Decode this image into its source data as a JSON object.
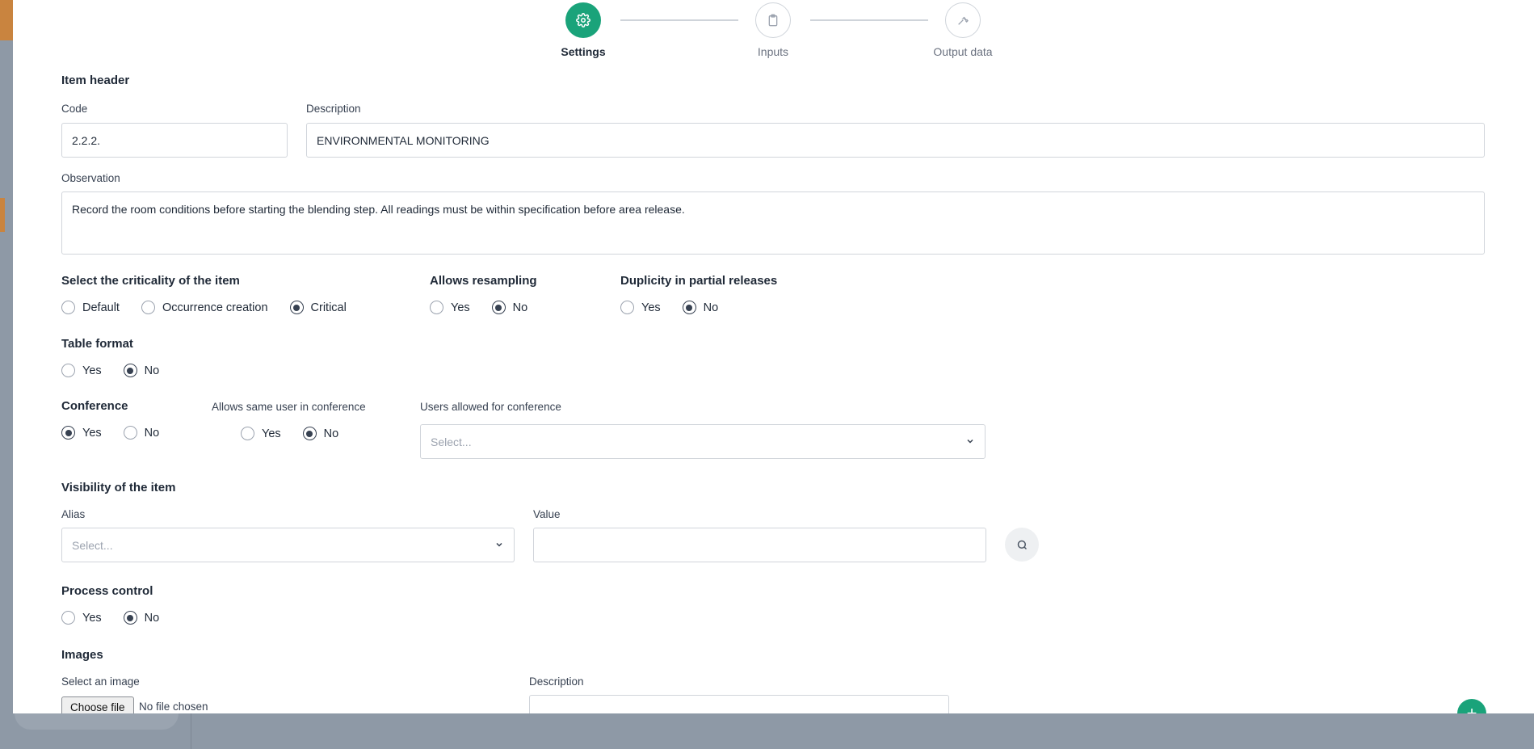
{
  "stepper": {
    "steps": [
      {
        "label": "Settings",
        "icon": "gear-icon",
        "active": true
      },
      {
        "label": "Inputs",
        "icon": "clipboard-icon",
        "active": false
      },
      {
        "label": "Output data",
        "icon": "wrench-icon",
        "active": false
      }
    ]
  },
  "item_header": {
    "title": "Item header",
    "code_label": "Code",
    "code_value": "2.2.2.",
    "description_label": "Description",
    "description_value": "ENVIRONMENTAL MONITORING",
    "observation_label": "Observation",
    "observation_value": "Record the room conditions before starting the blending step. All readings must be within specification before area release."
  },
  "criticality": {
    "title": "Select the criticality of the item",
    "options": [
      "Default",
      "Occurrence creation",
      "Critical"
    ],
    "selected": "Critical"
  },
  "resampling": {
    "title": "Allows resampling",
    "options": [
      "Yes",
      "No"
    ],
    "selected": "No"
  },
  "duplicity": {
    "title": "Duplicity in partial releases",
    "options": [
      "Yes",
      "No"
    ],
    "selected": "No"
  },
  "table_format": {
    "title": "Table format",
    "options": [
      "Yes",
      "No"
    ],
    "selected": "No"
  },
  "conference": {
    "title": "Conference",
    "options": [
      "Yes",
      "No"
    ],
    "selected": "Yes",
    "same_user_label": "Allows same user in conference",
    "same_user_options": [
      "Yes",
      "No"
    ],
    "same_user_selected": "No",
    "users_label": "Users allowed for conference",
    "users_placeholder": "Select..."
  },
  "visibility": {
    "title": "Visibility of the item",
    "alias_label": "Alias",
    "alias_placeholder": "Select...",
    "value_label": "Value",
    "value_value": ""
  },
  "process_control": {
    "title": "Process control",
    "options": [
      "Yes",
      "No"
    ],
    "selected": "No"
  },
  "images": {
    "title": "Images",
    "select_label": "Select an image",
    "choose_file_label": "Choose file",
    "file_status": "No file chosen",
    "description_label": "Description"
  },
  "fab": {
    "label": "+"
  },
  "colors": {
    "accent": "#1aa37a",
    "background_accent": "#c9843f"
  }
}
